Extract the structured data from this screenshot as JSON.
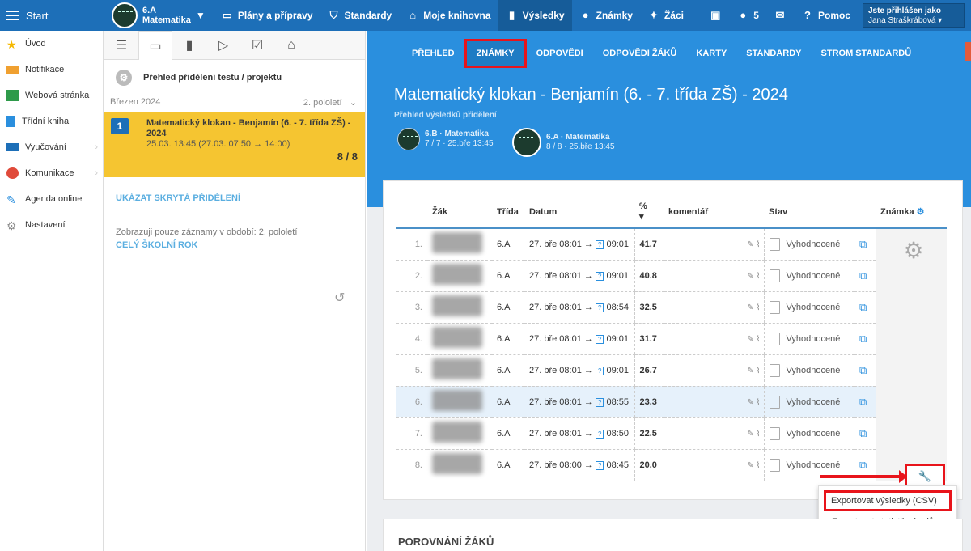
{
  "topbar": {
    "start": "Start",
    "class_name": "6.A",
    "class_subject": "Matematika",
    "items": [
      "Plány a přípravy",
      "Standardy",
      "Moje knihovna",
      "Výsledky",
      "Známky",
      "Žáci"
    ],
    "message_count": "5",
    "help": "Pomoc",
    "user_line1": "Jste přihlášen jako",
    "user_line2": "Jana Straškrábová"
  },
  "leftnav": {
    "items": [
      "Úvod",
      "Notifikace",
      "Webová stránka",
      "Třídní kniha",
      "Vyučování",
      "Komunikace",
      "Agenda online",
      "Nastavení"
    ]
  },
  "panel": {
    "overview": "Přehled přidělení testu / projektu",
    "month": "Březen 2024",
    "semester": "2. pololetí",
    "assignment": {
      "number": "1",
      "title": "Matematický klokan - Benjamín (6. - 7. třída ZŠ) - 2024",
      "date": "25.03. 13:45 (27.03. 07:50 → 14:00)",
      "count": "8 / 8"
    },
    "show_hidden": "UKÁZAT SKRYTÁ PŘIDĚLENÍ",
    "filter_note": "Zobrazuji pouze záznamy v období: 2. pololetí",
    "whole_year": "CELÝ ŠKOLNÍ ROK"
  },
  "subnav": [
    "PŘEHLED",
    "ZNÁMKY",
    "ODPOVĚDI",
    "ODPOVĚDI ŽÁKŮ",
    "KARTY",
    "STANDARDY",
    "STROM STANDARDŮ"
  ],
  "header": {
    "title": "Matematický klokan - Benjamín (6. - 7. třída ZŠ) - 2024",
    "subtitle": "Přehled výsledků přidělení",
    "classes": [
      {
        "name": "6.B · Matematika",
        "info": "7 / 7 · 25.bře 13:45"
      },
      {
        "name": "6.A · Matematika",
        "info": "8 / 8 · 25.bře 13:45"
      }
    ]
  },
  "table": {
    "headers": {
      "student": "Žák",
      "class": "Třída",
      "date": "Datum",
      "percent": "%",
      "comment": "komentář",
      "status": "Stav",
      "grade": "Známka"
    },
    "rows": [
      {
        "n": "1.",
        "cls": "6.A",
        "date": "27. bře 08:01 →",
        "end": "09:01",
        "pct": "41.7",
        "status": "Vyhodnocené"
      },
      {
        "n": "2.",
        "cls": "6.A",
        "date": "27. bře 08:01 →",
        "end": "09:01",
        "pct": "40.8",
        "status": "Vyhodnocené"
      },
      {
        "n": "3.",
        "cls": "6.A",
        "date": "27. bře 08:01 →",
        "end": "08:54",
        "pct": "32.5",
        "status": "Vyhodnocené"
      },
      {
        "n": "4.",
        "cls": "6.A",
        "date": "27. bře 08:01 →",
        "end": "09:01",
        "pct": "31.7",
        "status": "Vyhodnocené"
      },
      {
        "n": "5.",
        "cls": "6.A",
        "date": "27. bře 08:01 →",
        "end": "09:01",
        "pct": "26.7",
        "status": "Vyhodnocené"
      },
      {
        "n": "6.",
        "cls": "6.A",
        "date": "27. bře 08:01 →",
        "end": "08:55",
        "pct": "23.3",
        "status": "Vyhodnocené"
      },
      {
        "n": "7.",
        "cls": "6.A",
        "date": "27. bře 08:01 →",
        "end": "08:50",
        "pct": "22.5",
        "status": "Vyhodnocené"
      },
      {
        "n": "8.",
        "cls": "6.A",
        "date": "27. bře 08:00 →",
        "end": "08:45",
        "pct": "20.0",
        "status": "Vyhodnocené"
      }
    ]
  },
  "dropdown": {
    "export_csv": "Exportovat výsledky (CSV)",
    "export_stats": "Exportovat statistiku bodů"
  },
  "section2": "POROVNÁNÍ ŽÁKŮ",
  "colors": {
    "primary": "#1d6fb8",
    "header": "#2a8fde",
    "highlight": "#e8141b",
    "assignment": "#f5c531"
  }
}
